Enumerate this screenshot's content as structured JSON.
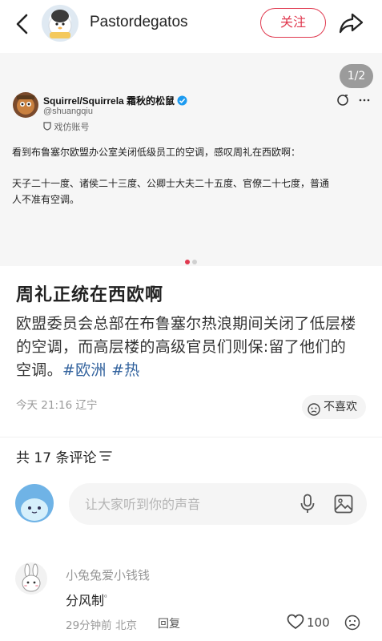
{
  "header": {
    "author": "Pastordegatos",
    "follow_label": "关注"
  },
  "carousel": {
    "page_indicator": "1/2",
    "tweet": {
      "name": "Squirrel/Squirrela 霜秋的松鼠",
      "handle": "@shuangqiu",
      "account_tag": "戏仿账号",
      "line1": "看到布鲁塞尔欧盟办公室关闭低级员工的空调，感叹周礼在西欧啊：",
      "line2": "天子二十一度、诸侯二十三度、公卿士大夫二十五度、官僚二十七度，普通",
      "line3": "人不准有空调。"
    }
  },
  "post": {
    "title": "周礼正统在西欧啊",
    "body_line1": "欧盟委员会总部在布鲁塞尔热浪期间关闭了低层楼",
    "body_line2": "的空调，而高层楼的高级官员们则保:留了他们的",
    "body_line3_prefix": "空调。",
    "tag1": "#欧洲",
    "tag2": "#热",
    "meta": "今天 21:16 辽宁",
    "dislike_label": "不喜欢"
  },
  "comments": {
    "count_label": "共 17 条评论",
    "input_placeholder": "让大家听到你的声音",
    "items": [
      {
        "user": "小兔兔爱小钱钱",
        "text": "分风制",
        "time_location": "29分钟前 北京",
        "reply_label": "回复",
        "likes": "100"
      }
    ]
  },
  "colors": {
    "accent": "#e0394f",
    "tag": "#33639e"
  }
}
